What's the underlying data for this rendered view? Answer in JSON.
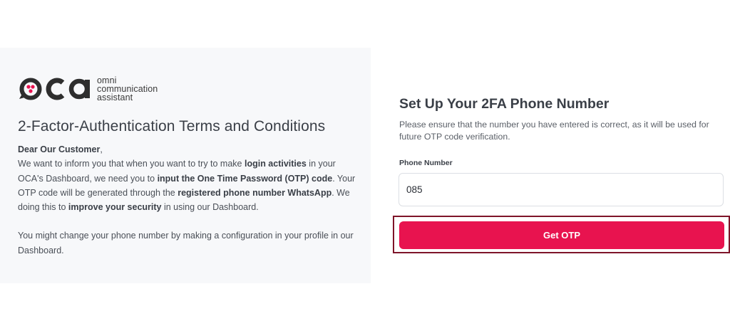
{
  "brand": {
    "logo_letters": "oca",
    "logo_line1": "omni",
    "logo_line2": "communication",
    "logo_line3": "assistant",
    "accent_color": "#e8134f",
    "dark_color": "#2e2e2e"
  },
  "terms": {
    "title": "2-Factor-Authentication Terms and Conditions",
    "greeting": "Dear Our Customer",
    "greeting_comma": ",",
    "p1_a": "We want to inform you that when you want to try to make ",
    "p1_b": "login activities",
    "p1_c": " in your OCA's Dashboard, we need you to ",
    "p1_d": "input the One Time Password (OTP) code",
    "p1_e": ". Your OTP code will be generated through the ",
    "p1_f": "registered phone number WhatsApp",
    "p1_g": ". We doing this to ",
    "p1_h": "improve your security",
    "p1_i": " in using our Dashboard.",
    "p2": "You might change your phone number by making a configuration in your profile in our Dashboard."
  },
  "setup": {
    "title": "Set Up Your 2FA Phone Number",
    "description": "Please ensure that the number you have entered is correct, as it will be used for future OTP code verification.",
    "phone_label": "Phone Number",
    "phone_value": "085",
    "button_label": "Get OTP"
  }
}
